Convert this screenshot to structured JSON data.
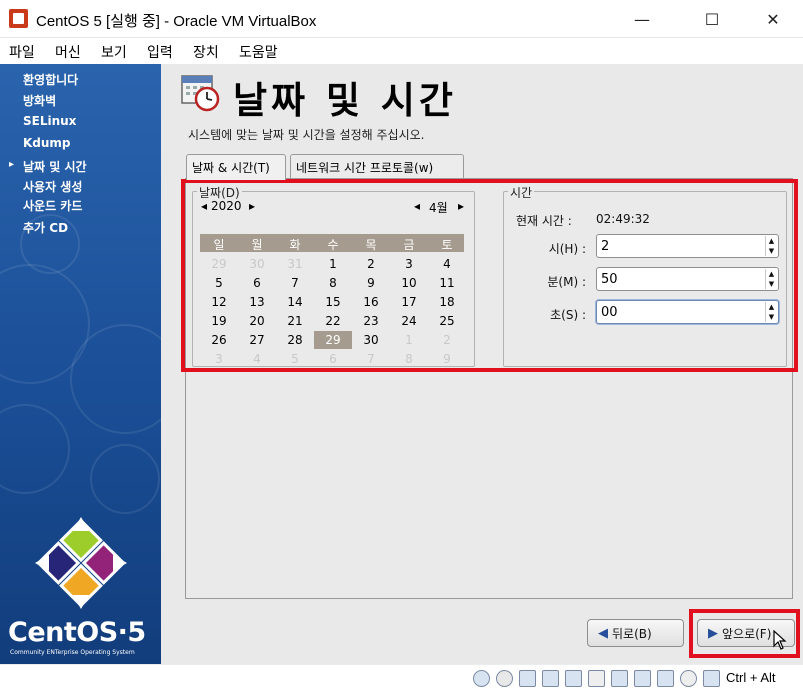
{
  "window": {
    "title": "CentOS 5 [실행 중] - Oracle VM VirtualBox",
    "minimize": "—",
    "maximize": "☐",
    "close": "✕"
  },
  "menu": [
    "파일",
    "머신",
    "보기",
    "입력",
    "장치",
    "도움말"
  ],
  "sidebar": {
    "items": [
      "환영합니다",
      "방화벽",
      "SELinux",
      "Kdump",
      "날짜 및 시간",
      "사용자 생성",
      "사운드 카드",
      "추가 CD"
    ],
    "current_marker": "▸",
    "logo_text": "CentOS·5",
    "logo_sub": "Community ENTerprise Operating System"
  },
  "page": {
    "title": "날짜 및 시간",
    "subtitle": "시스템에 맞는 날짜 및 시간을 설정해 주십시오."
  },
  "tabs": [
    "날짜 & 시간(T)",
    "네트워크 시간 프로토콜(w)"
  ],
  "date_frame": {
    "label": "날짜(D)",
    "year": "2020",
    "month": "4월",
    "prev": "◂",
    "next": "▸",
    "weekdays": [
      "일",
      "월",
      "화",
      "수",
      "목",
      "금",
      "토"
    ],
    "days": [
      [
        "29",
        "30",
        "31",
        "1",
        "2",
        "3",
        "4"
      ],
      [
        "5",
        "6",
        "7",
        "8",
        "9",
        "10",
        "11"
      ],
      [
        "12",
        "13",
        "14",
        "15",
        "16",
        "17",
        "18"
      ],
      [
        "19",
        "20",
        "21",
        "22",
        "23",
        "24",
        "25"
      ],
      [
        "26",
        "27",
        "28",
        "29",
        "30",
        "1",
        "2"
      ],
      [
        "3",
        "4",
        "5",
        "6",
        "7",
        "8",
        "9"
      ]
    ],
    "selected_day": "29"
  },
  "time_frame": {
    "label": "시간",
    "current_label": "현재 시간 :",
    "current_value": "02:49:32",
    "hour_label": "시(H) :",
    "hour_value": "2",
    "minute_label": "분(M) :",
    "minute_value": "50",
    "second_label": "초(S) :",
    "second_value": "00"
  },
  "buttons": {
    "back": "뒤로(B)",
    "next": "앞으로(F)"
  },
  "statusbar": {
    "host_key": "Ctrl + Alt"
  },
  "colors": {
    "highlight_box": "#e0101f",
    "sidebar_blue": "#1d4f90",
    "calendar_header": "#a59c8f"
  }
}
